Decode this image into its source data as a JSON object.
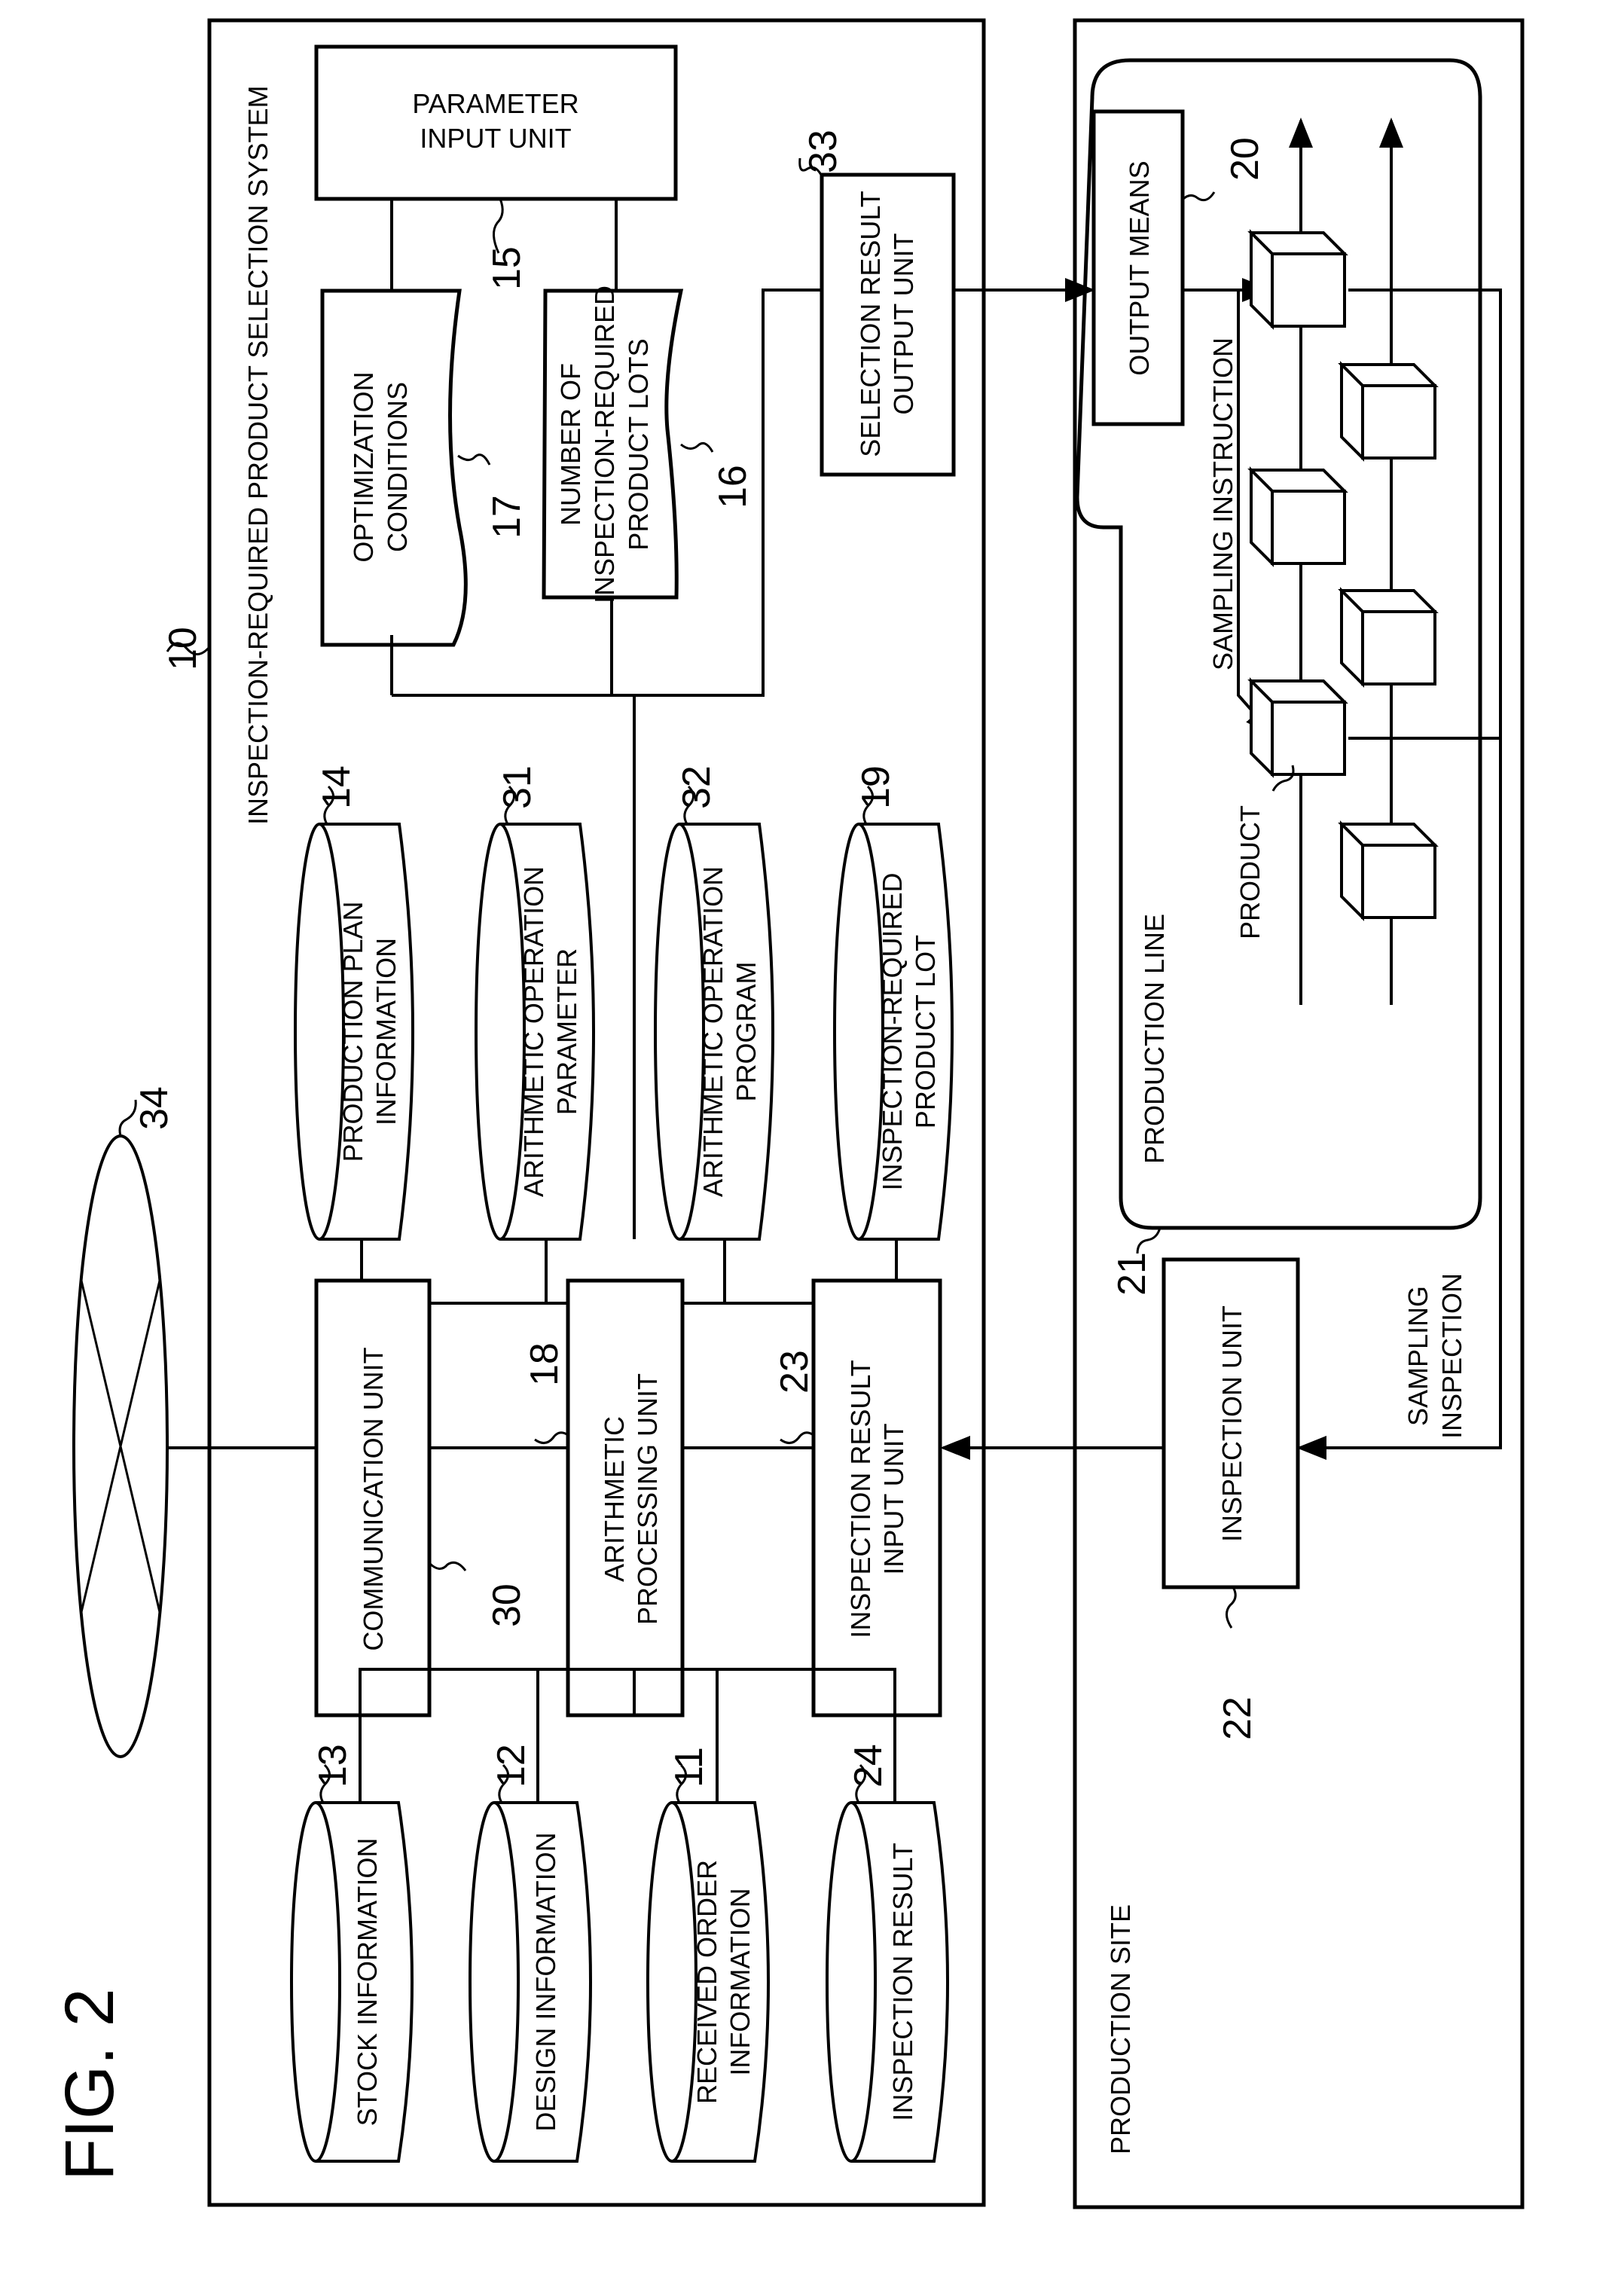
{
  "figure_label": "FIG. 2",
  "system": {
    "ref": "10",
    "title": "INSPECTION-REQUIRED PRODUCT SELECTION SYSTEM",
    "parameter_input_unit": {
      "ref": "15",
      "lines": [
        "PARAMETER",
        "INPUT UNIT"
      ]
    },
    "optimization_conditions": {
      "ref": "17",
      "lines": [
        "OPTIMIZATION",
        "CONDITIONS"
      ]
    },
    "inspection_lots_count": {
      "ref": "16",
      "lines": [
        "NUMBER OF",
        "INSPECTION-REQUIRED",
        "PRODUCT LOTS"
      ]
    },
    "selection_result_output_unit": {
      "ref": "33",
      "lines": [
        "SELECTION RESULT",
        "OUTPUT UNIT"
      ]
    },
    "upper_datastores": [
      {
        "ref": "14",
        "lines": [
          "PRODUCTION PLAN",
          "INFORMATION"
        ]
      },
      {
        "ref": "31",
        "lines": [
          "ARITHMETIC OPERATION",
          "PARAMETER"
        ]
      },
      {
        "ref": "32",
        "lines": [
          "ARITHMETIC OPERATION",
          "PROGRAM"
        ]
      },
      {
        "ref": "19",
        "lines": [
          "INSPECTION-REQUIRED",
          "PRODUCT LOT"
        ]
      }
    ],
    "communication_unit": {
      "ref": "30",
      "lines": [
        "COMMUNICATION UNIT"
      ]
    },
    "arithmetic_processing_unit": {
      "ref": "18",
      "lines": [
        "ARITHMETIC",
        "PROCESSING UNIT"
      ]
    },
    "inspection_result_input_unit": {
      "ref": "23",
      "lines": [
        "INSPECTION RESULT",
        "INPUT UNIT"
      ]
    },
    "lower_datastores": [
      {
        "ref": "13",
        "lines": [
          "STOCK INFORMATION"
        ]
      },
      {
        "ref": "12",
        "lines": [
          "DESIGN INFORMATION"
        ]
      },
      {
        "ref": "11",
        "lines": [
          "RECEIVED ORDER",
          "INFORMATION"
        ]
      },
      {
        "ref": "24",
        "lines": [
          "INSPECTION RESULT"
        ]
      }
    ]
  },
  "network": {
    "ref": "34"
  },
  "production_site": {
    "title": "PRODUCTION SITE",
    "production_line": {
      "ref": "21",
      "title": "PRODUCTION LINE"
    },
    "output_means": {
      "ref": "20",
      "lines": [
        "OUTPUT MEANS"
      ]
    },
    "inspection_unit": {
      "ref": "22",
      "lines": [
        "INSPECTION UNIT"
      ]
    },
    "product_label": "PRODUCT",
    "sampling_instruction_label": "SAMPLING INSTRUCTION",
    "sampling_inspection_lines": [
      "SAMPLING",
      "INSPECTION"
    ]
  }
}
